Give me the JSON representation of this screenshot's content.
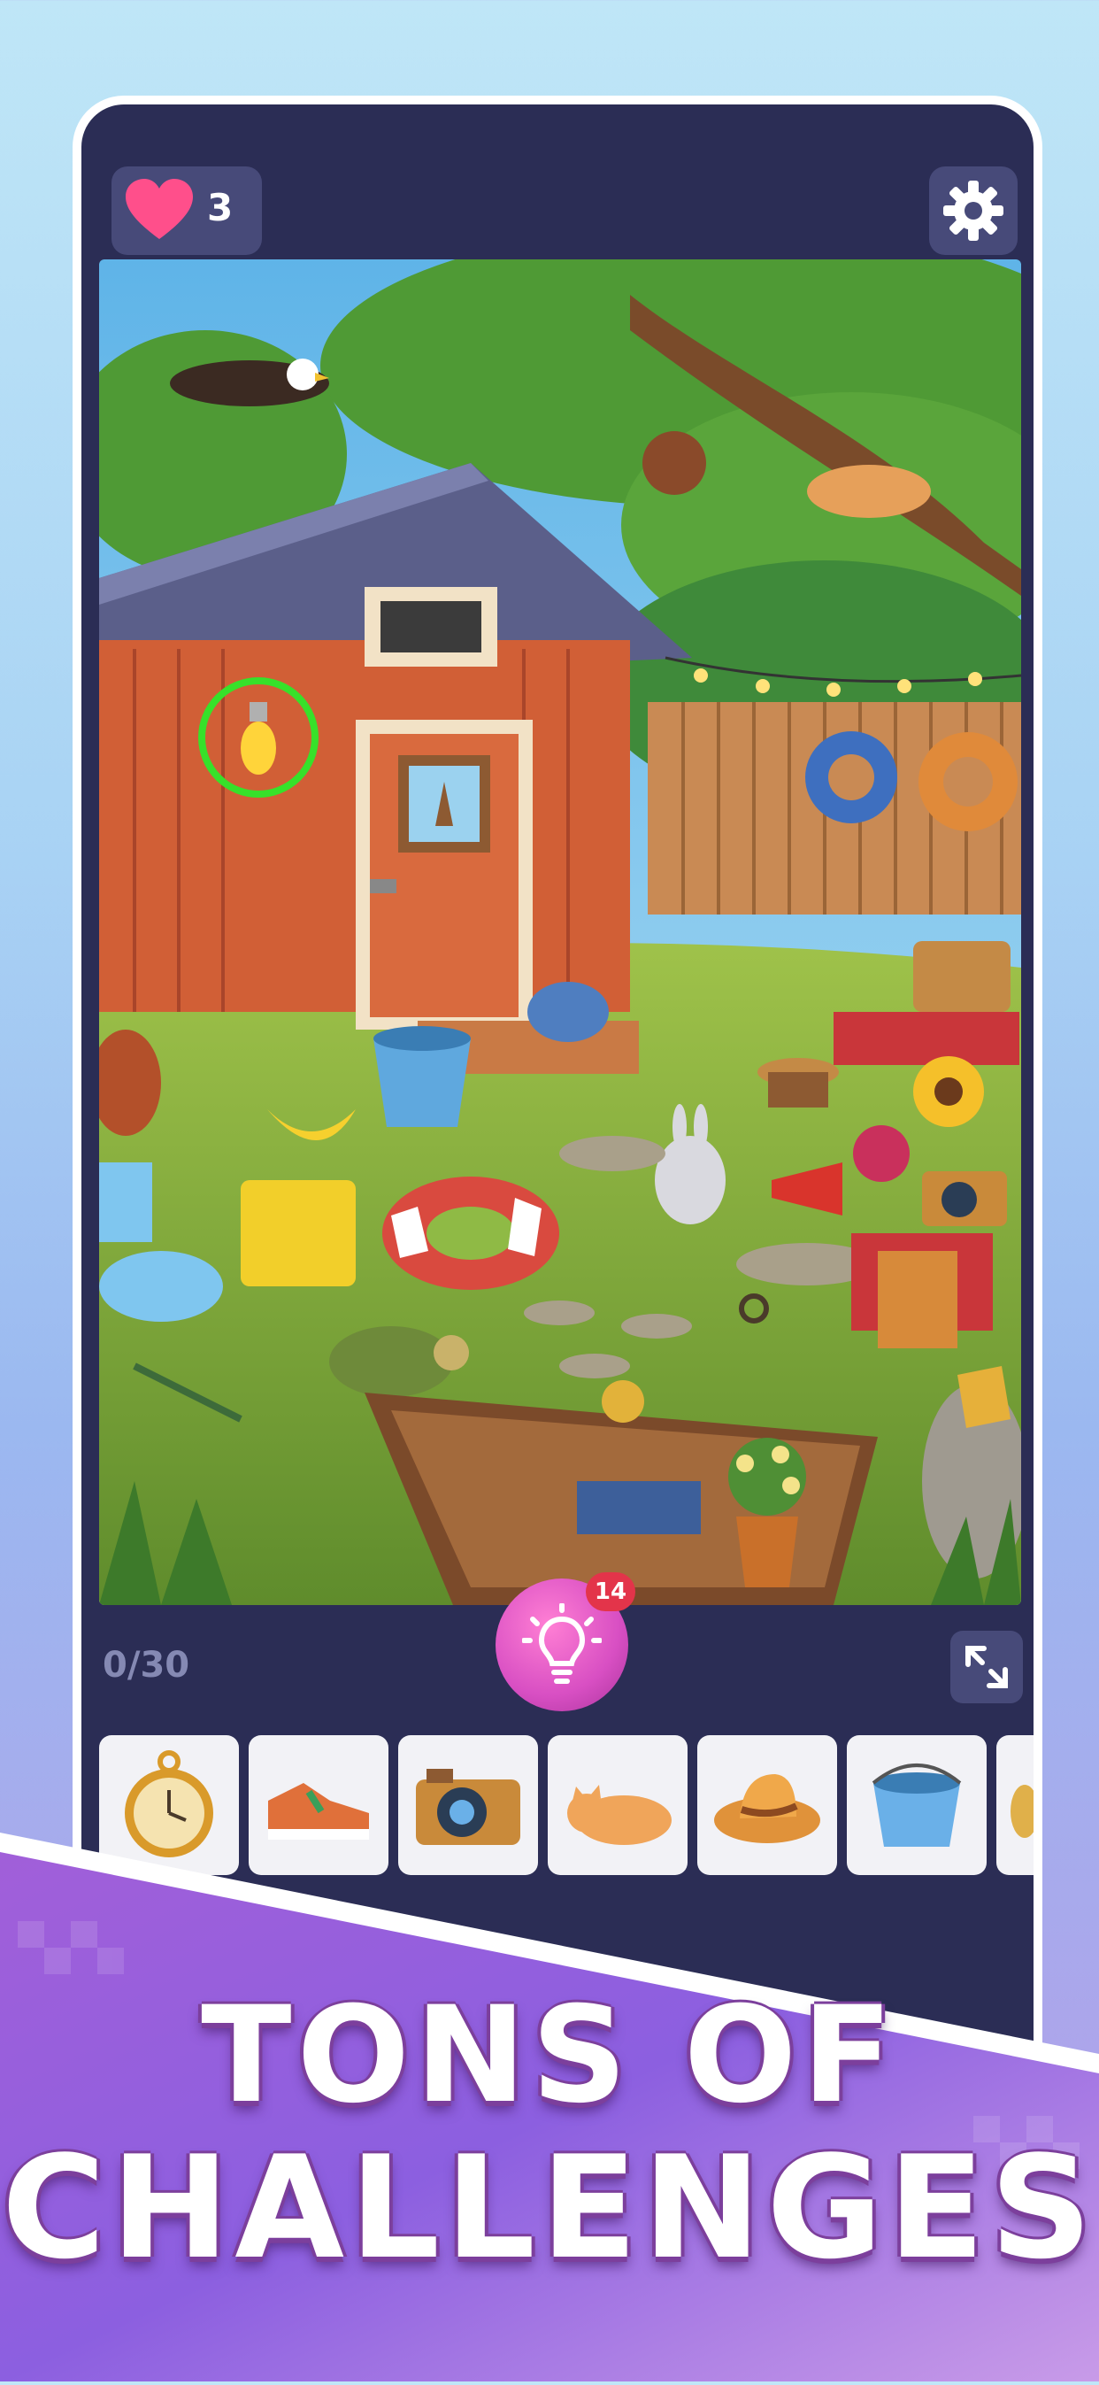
{
  "hud": {
    "lives": "3",
    "progress": "0/30",
    "hint_count": "14"
  },
  "icons": {
    "lives": "heart-icon",
    "settings": "gear-icon",
    "hint": "lightbulb-icon",
    "expand": "expand-arrows-icon"
  },
  "scene": {
    "found_marker": "lightbulb"
  },
  "targets": [
    {
      "name": "pocket-watch"
    },
    {
      "name": "sneaker"
    },
    {
      "name": "camera"
    },
    {
      "name": "sleeping-cat"
    },
    {
      "name": "straw-hat"
    },
    {
      "name": "bucket"
    },
    {
      "name": "partial-item"
    }
  ],
  "banner": {
    "line1": "TONS OF",
    "line2": "CHALLENGES"
  },
  "colors": {
    "panel": "#2b2d55",
    "accent_pink": "#d84fc3",
    "heart": "#ff4f8b",
    "found_ring": "#37e12a"
  }
}
